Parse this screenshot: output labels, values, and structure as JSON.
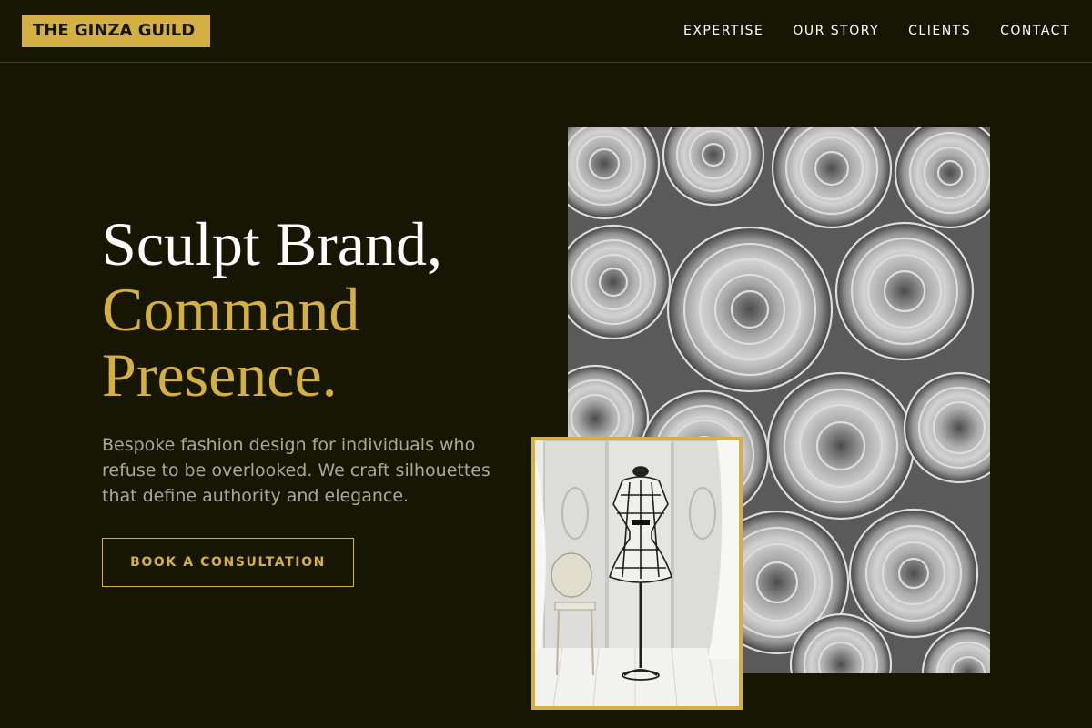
{
  "header": {
    "logo": "THE GINZA GUILD",
    "nav": [
      "EXPERTISE",
      "OUR STORY",
      "CLIENTS",
      "CONTACT"
    ]
  },
  "hero": {
    "headline_line1": "Sculpt Brand,",
    "headline_line2": "Command",
    "headline_line3": "Presence.",
    "subtext": "Bespoke fashion design for individuals who refuse to be overlooked. We craft silhouettes that define authority and elegance.",
    "cta_label": "BOOK A CONSULTATION"
  },
  "colors": {
    "background": "#161602",
    "accent": "#d4b044",
    "text_primary": "#ffffff",
    "text_muted": "#a8a8a0"
  },
  "images": {
    "main": "rolled-fabric-photo",
    "inset": "dress-form-mannequin-photo"
  }
}
